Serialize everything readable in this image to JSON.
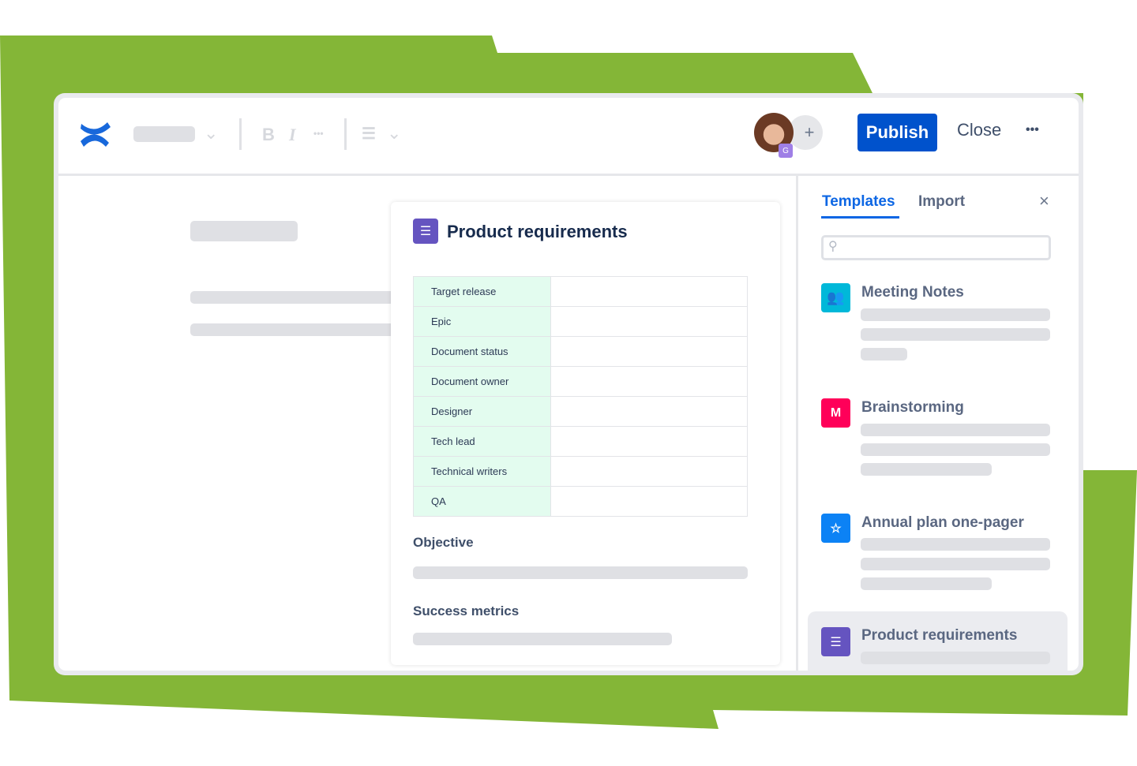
{
  "colors": {
    "background_shape": "#84b637",
    "primary": "#0052cc",
    "link": "#0c66e4",
    "template_icon": "#6554c0"
  },
  "toolbar": {
    "bold": "B",
    "italic": "I",
    "more": "•••",
    "align_icon": "align-left-icon",
    "publish_label": "Publish",
    "close_label": "Close",
    "overflow": "•••",
    "add_collaborator": "+",
    "avatar_badge": "G"
  },
  "document": {
    "title": "Product requirements",
    "table": [
      {
        "label": "Target release",
        "value": ""
      },
      {
        "label": "Epic",
        "value": ""
      },
      {
        "label": "Document status",
        "value": ""
      },
      {
        "label": "Document owner",
        "value": ""
      },
      {
        "label": "Designer",
        "value": ""
      },
      {
        "label": "Tech lead",
        "value": ""
      },
      {
        "label": "Technical writers",
        "value": ""
      },
      {
        "label": "QA",
        "value": ""
      }
    ],
    "sections": [
      "Objective",
      "Success metrics"
    ]
  },
  "panel": {
    "tabs": [
      "Templates",
      "Import"
    ],
    "active_tab": "Templates",
    "close": "×",
    "search_placeholder": "",
    "templates": [
      {
        "name": "Meeting Notes",
        "icon": "people-icon",
        "color": "#00b8d9"
      },
      {
        "name": "Brainstorming",
        "icon": "miro-icon",
        "color": "#ff0059",
        "glyph": "M"
      },
      {
        "name": "Annual plan one-pager",
        "icon": "star-board-icon",
        "color": "#0c82f5"
      },
      {
        "name": "Product requirements",
        "icon": "list-icon",
        "color": "#6554c0",
        "selected": true
      }
    ]
  }
}
